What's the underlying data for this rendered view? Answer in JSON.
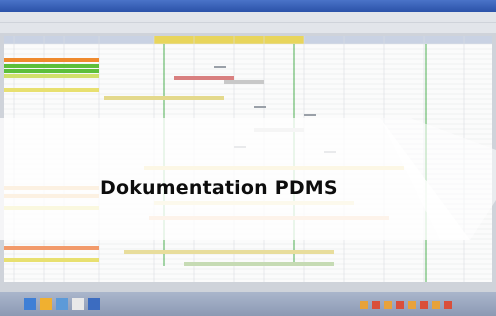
{
  "caption": {
    "text": "Dokumentation PDMS"
  }
}
